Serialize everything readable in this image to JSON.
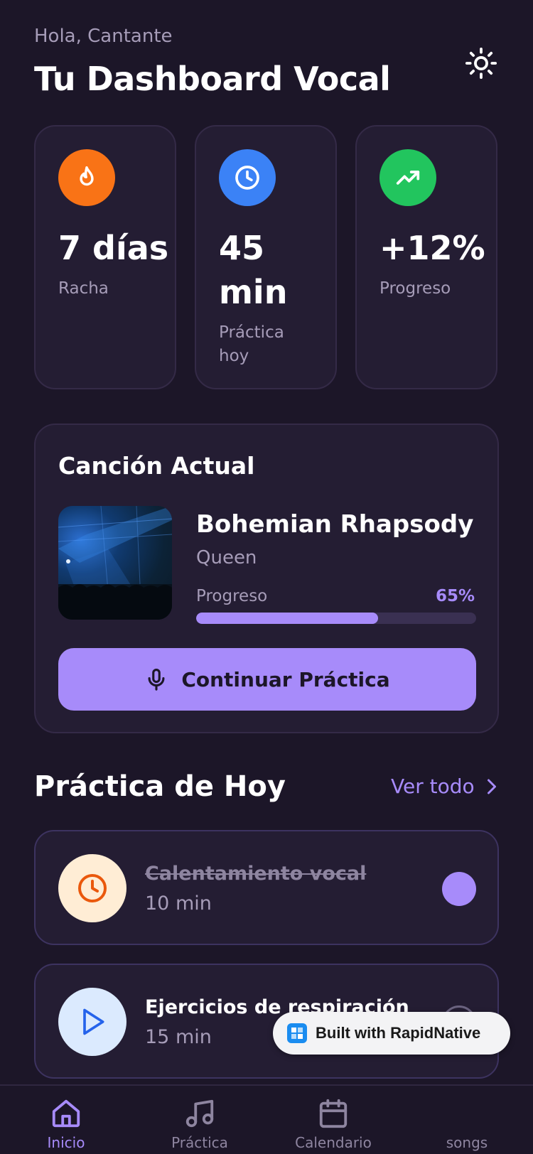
{
  "header": {
    "greeting": "Hola, Cantante",
    "title": "Tu Dashboard Vocal",
    "theme_icon": "sun-icon"
  },
  "stats": [
    {
      "icon": "flame-icon",
      "color": "#f97316",
      "value": "7 días",
      "label": "Racha"
    },
    {
      "icon": "clock-icon",
      "color": "#3b82f6",
      "value": "45 min",
      "label": "Práctica hoy"
    },
    {
      "icon": "trending-up-icon",
      "color": "#22c55e",
      "value": "+12%",
      "label": "Progreso"
    }
  ],
  "current_song": {
    "section_title": "Canción Actual",
    "name": "Bohemian Rhapsody",
    "artist": "Queen",
    "progress_label": "Progreso",
    "progress_text": "65%",
    "progress_value": 0.65,
    "button_label": "Continuar Práctica",
    "button_icon": "microphone-icon"
  },
  "practice": {
    "section_title": "Práctica de Hoy",
    "see_all_label": "Ver todo",
    "tasks": [
      {
        "title": "Calentamiento vocal",
        "duration": "10 min",
        "icon": "clock-icon",
        "done": true
      },
      {
        "title": "Ejercicios de respiración",
        "duration": "15 min",
        "icon": "play-icon",
        "done": false
      }
    ]
  },
  "badge": {
    "label": "Built with RapidNative"
  },
  "nav": {
    "items": [
      {
        "label": "Inicio",
        "icon": "home-icon",
        "active": true
      },
      {
        "label": "Práctica",
        "icon": "music-note-icon",
        "active": false
      },
      {
        "label": "Calendario",
        "icon": "calendar-icon",
        "active": false
      },
      {
        "label": "songs",
        "icon": "songs-icon",
        "active": false
      }
    ]
  },
  "colors": {
    "background": "#1c1628",
    "card": "#241d33",
    "accent": "#a78bfa",
    "muted": "#a69cb8"
  }
}
